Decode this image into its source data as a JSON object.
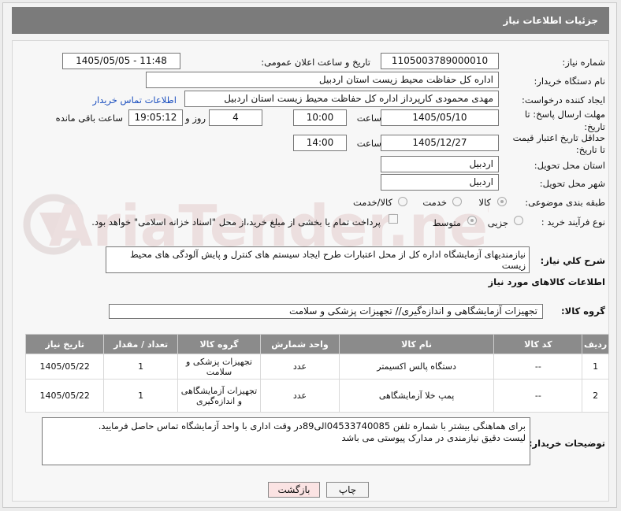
{
  "header": {
    "title": "جزئیات اطلاعات نیاز"
  },
  "form": {
    "need_number_label": "شماره نیاز:",
    "need_number": "1105003789000010",
    "announce_label": "تاریخ و ساعت اعلان عمومی:",
    "announce_value": "1405/05/05 - 11:48",
    "buyer_org_label": "نام دستگاه خریدار:",
    "buyer_org": "اداره کل حفاظت محیط زیست استان اردبیل",
    "creator_label": "ایجاد کننده درخواست:",
    "creator": "مهدی محمودی کارپرداز اداره کل حفاظت محیط زیست استان اردبیل",
    "contact_link": "اطلاعات تماس خریدار",
    "deadline_label_1": "مهلت ارسال پاسخ: تا",
    "deadline_label_2": "تاریخ:",
    "deadline_date": "1405/05/10",
    "time_label": "ساعت",
    "deadline_time": "10:00",
    "days_value": "4",
    "days_label": "روز و",
    "remaining_time": "19:05:12",
    "remaining_label": "ساعت باقی مانده",
    "price_validity_label_1": "حداقل تاریخ اعتبار قیمت",
    "price_validity_label_2": "تا تاریخ:",
    "validity_date": "1405/12/27",
    "validity_time": "14:00",
    "province_label": "استان محل تحویل:",
    "province": "اردبیل",
    "city_label": "شهر محل تحویل:",
    "city": "اردبیل",
    "category_label": "طبقه بندی موضوعی:",
    "category_options": [
      "کالا",
      "خدمت",
      "کالا/خدمت"
    ],
    "process_label": "نوع فرآیند خرید :",
    "process_options": [
      "جزیی",
      "متوسط"
    ],
    "payment_note": "پرداخت تمام یا بخشی از مبلغ خرید،از محل \"اسناد خزانه اسلامی\" خواهد بود.",
    "summary_label": "شرح کلي نياز:",
    "summary": "نیازمندیهای آزمایشگاه اداره کل از محل اعتبارات  طرح ایجاد سیستم های کنترل و پایش آلودگی های محیط زیست"
  },
  "goods": {
    "section_title": "اطلاعات کالاهای مورد نیاز",
    "group_label": "گروه کالا:",
    "group_value": "تجهیزات آزمایشگاهی و اندازه‌گیری// تجهیزات پزشکی و سلامت",
    "columns": [
      "ردیف",
      "کد کالا",
      "نام کالا",
      "واحد شمارش",
      "گروه کالا",
      "تعداد / مقدار",
      "تاریخ نیاز"
    ],
    "rows": [
      {
        "row": "1",
        "code": "--",
        "name": "دستگاه پالس اکسیمتر",
        "unit": "عدد",
        "group": "تجهیزات پزشکی و سلامت",
        "qty": "1",
        "date": "1405/05/22"
      },
      {
        "row": "2",
        "code": "--",
        "name": "پمپ خلا آزمایشگاهی",
        "unit": "عدد",
        "group": "تجهیزات آزمایشگاهی و اندازه‌گیری",
        "qty": "1",
        "date": "1405/05/22"
      }
    ]
  },
  "notes": {
    "label": "توضیحات خریدار:",
    "line1": "برای هماهنگی بیشتر با شماره تلفن 04533740085الی89در وقت اداری با واحد آزمایشگاه تماس حاصل فرمایید.",
    "line2": "لیست دقیق نیازمندی در مدارک پیوستی می باشد"
  },
  "buttons": {
    "print": "چاپ",
    "back": "بازگشت"
  },
  "watermark": {
    "text": "AriaTender.neT"
  },
  "colors": {
    "header_bg": "#7b7b7b",
    "table_header_bg": "#8b8b8b",
    "link": "#1b4fbf",
    "back_button_bg": "#fbe3e3"
  }
}
